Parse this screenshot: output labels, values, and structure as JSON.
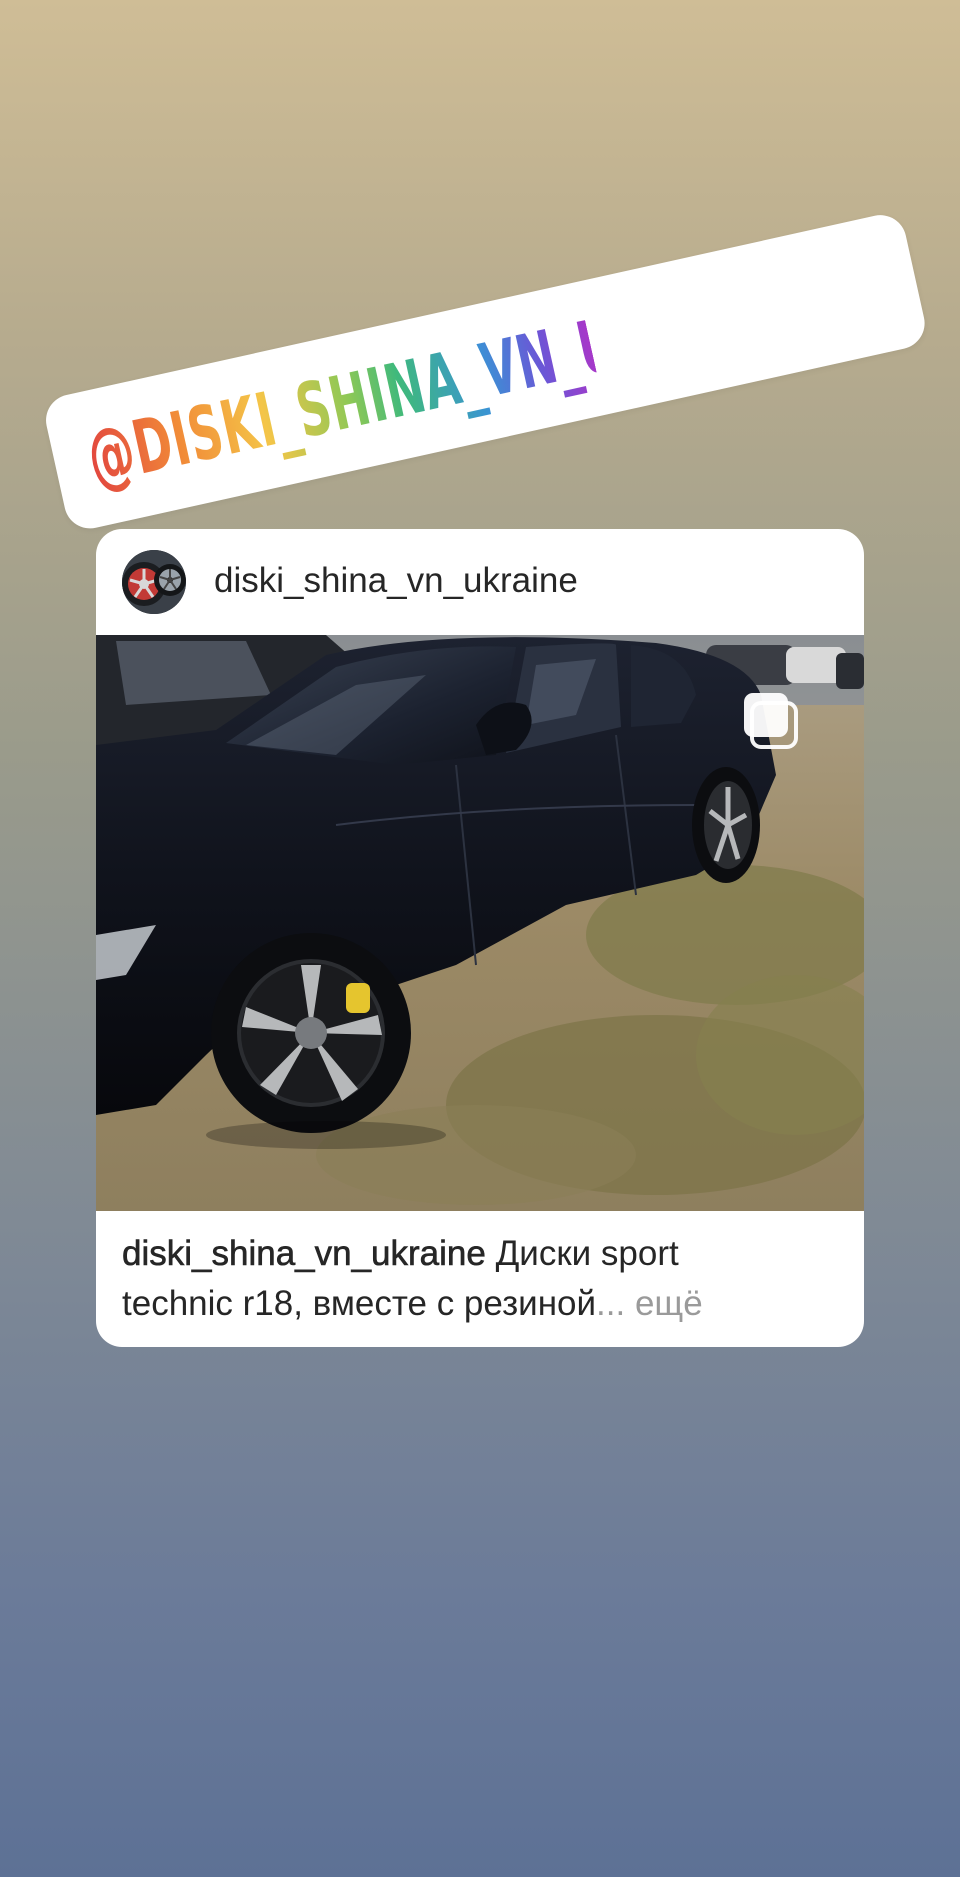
{
  "story": {
    "mention_sticker": {
      "text": "@DISKI_SHINA_VN_UKRAINE"
    },
    "post": {
      "username": "diski_shina_vn_ukraine",
      "avatar_icon": "wheel-rim-avatar-icon",
      "photo_description_icon": "car-photo",
      "multi_photo_icon": "carousel-icon",
      "caption": {
        "username": "diski_shina_vn_ukraine",
        "text_line1": " Диски sport",
        "text_line2": "technic r18, вместе с резиной",
        "more": "... ещё"
      }
    },
    "colors": {
      "background_top": "#cfbd96",
      "background_bottom": "#5d7195",
      "card": "#ffffff",
      "text": "#262626",
      "muted": "#9a9a9a"
    }
  }
}
